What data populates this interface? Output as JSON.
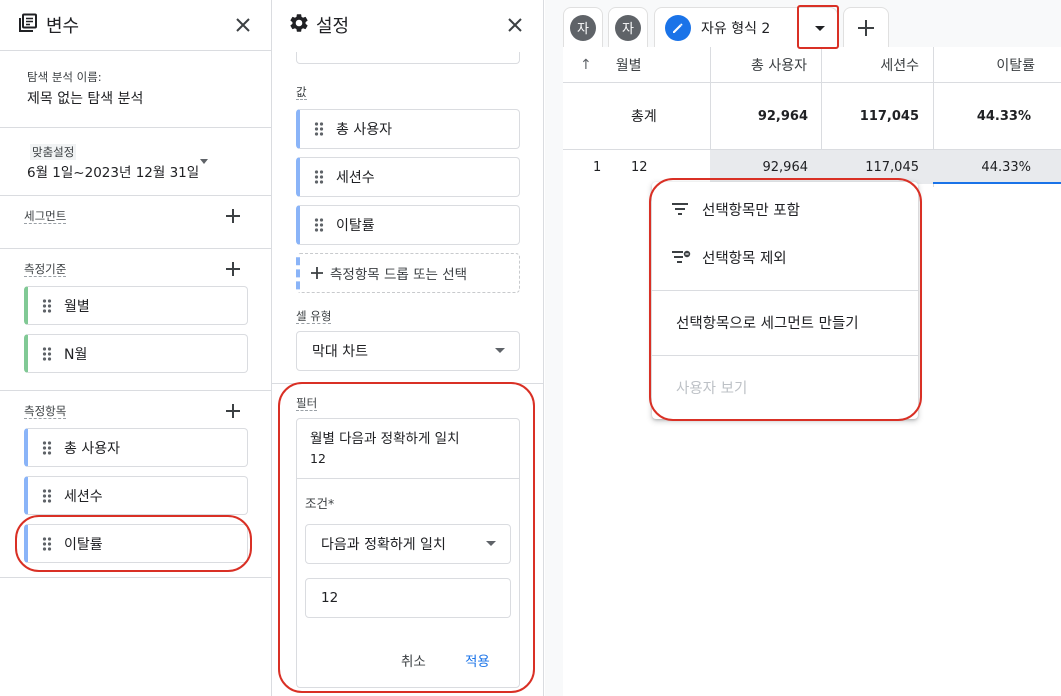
{
  "variables": {
    "title": "변수",
    "exploration_name_label": "탐색 분석 이름:",
    "exploration_name": "제목 없는 탐색 분석",
    "date_label": "맞춤설정",
    "date_range": "6월 1일~2023년 12월 31일",
    "segments_label": "세그먼트",
    "dimensions_label": "측정기준",
    "dimensions": [
      "월별",
      "N월"
    ],
    "metrics_label": "측정항목",
    "metrics": [
      "총 사용자",
      "세션수",
      "이탈률"
    ]
  },
  "settings": {
    "title": "설정",
    "values_label": "값",
    "values": [
      "총 사용자",
      "세션수",
      "이탈률"
    ],
    "drop_metric": "측정항목 드롭 또는 선택",
    "cell_type_label": "셀 유형",
    "cell_type": "막대 차트",
    "filter": {
      "label": "필터",
      "summary_line1": "월별 다음과 정확하게 일치",
      "summary_line2": "12",
      "condition_label": "조건*",
      "condition": "다음과 정확하게 일치",
      "value": "12",
      "cancel": "취소",
      "apply": "적용"
    }
  },
  "tabs": {
    "tab1": "자",
    "tab2": "자",
    "active": "자유 형식 2"
  },
  "table": {
    "sort_arrow": "↑",
    "headers": [
      "월별",
      "총 사용자",
      "세션수",
      "이탈률"
    ],
    "totals_label": "총계",
    "totals": [
      "92,964",
      "117,045",
      "44.33%"
    ],
    "rows": [
      {
        "index": "1",
        "month": "12",
        "values": [
          "92,964",
          "117,045",
          "44.33%"
        ]
      }
    ]
  },
  "context_menu": {
    "include_only": "선택항목만 포함",
    "exclude": "선택항목 제외",
    "create_segment": "선택항목으로 세그먼트 만들기",
    "view_users": "사용자 보기"
  },
  "colors": {
    "accent": "#1a73e8",
    "highlight": "#d93025",
    "dimension_bar": "#81c995",
    "metric_bar": "#8ab4f8"
  }
}
